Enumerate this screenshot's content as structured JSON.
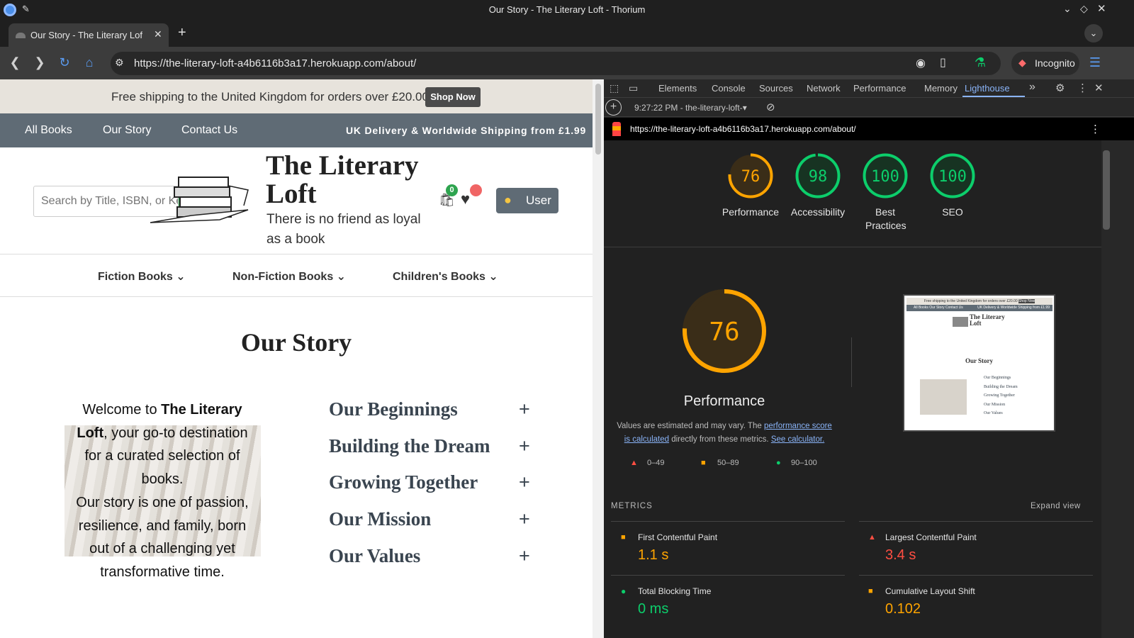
{
  "window": {
    "title": "Our Story - The Literary Loft - Thorium"
  },
  "tab": {
    "label": "Our Story - The Literary Lof"
  },
  "address": {
    "url": "https://the-literary-loft-a4b6116b3a17.herokuapp.com/about/",
    "incognito_label": "Incognito"
  },
  "site": {
    "promo_text": "Free shipping to the United Kingdom for orders over £20.00",
    "promo_button": "Shop Now",
    "nav": [
      "All Books",
      "Our Story",
      "Contact Us"
    ],
    "nav_right": "UK Delivery & Worldwide Shipping from £1.99",
    "search_placeholder": "Search by Title, ISBN, or Keyword",
    "brand_title_line1": "The Literary",
    "brand_title_line2": "Loft",
    "tagline_line1": "There is no friend as loyal",
    "tagline_line2": "as a book",
    "cart_count": "0",
    "user_button": "User",
    "categories": [
      "Fiction Books",
      "Non-Fiction Books",
      "Children's Books"
    ],
    "page_heading": "Our Story",
    "intro": {
      "l1a": "Welcome to ",
      "l1b": "The Literary",
      "l2a": "Loft",
      "l2b": ", your go-to destination",
      "l3": "for a curated selection of",
      "l4": "books.",
      "l5": "Our story is one of passion,",
      "l6": "resilience, and family, born",
      "l7": "out of a challenging yet",
      "l8": "transformative time."
    },
    "accordion": [
      "Our Beginnings",
      "Building the Dream",
      "Growing Together",
      "Our Mission",
      "Our Values"
    ]
  },
  "devtools": {
    "tabs": [
      "Elements",
      "Console",
      "Sources",
      "Network",
      "Performance",
      "Memory",
      "Lighthouse"
    ],
    "active_tab": "Lighthouse",
    "report_selector": "9:27:22 PM - the-literary-loft-",
    "report_url": "https://the-literary-loft-a4b6116b3a17.herokuapp.com/about/",
    "scores": [
      {
        "label": "Performance",
        "value": 76,
        "color": "#ffa400"
      },
      {
        "label": "Accessibility",
        "value": 98,
        "color": "#0cce6b"
      },
      {
        "label": "Best Practices",
        "value": 100,
        "color": "#0cce6b"
      },
      {
        "label": "SEO",
        "value": 100,
        "color": "#0cce6b"
      }
    ],
    "big_score": {
      "label": "Performance",
      "value": 76
    },
    "note_pre": "Values are estimated and may vary. The ",
    "note_link1a": "performance score",
    "note_link1b": "is calculated",
    "note_mid": " directly from these metrics. ",
    "note_link2": "See calculator.",
    "legend": [
      "0–49",
      "50–89",
      "90–100"
    ],
    "metrics_header": "METRICS",
    "expand_view": "Expand view",
    "metrics": [
      {
        "name": "First Contentful Paint",
        "value": "1.1 s",
        "status": "average"
      },
      {
        "name": "Largest Contentful Paint",
        "value": "3.4 s",
        "status": "fail"
      },
      {
        "name": "Total Blocking Time",
        "value": "0 ms",
        "status": "pass"
      },
      {
        "name": "Cumulative Layout Shift",
        "value": "0.102",
        "status": "average"
      }
    ],
    "thumb": {
      "promo": "Free shipping to the United Kingdom for orders over £20.00",
      "promo_btn": "Shop Now",
      "nav": "All Books   Our Story   Contact Us",
      "nav_right": "UK Delivery & Worldwide Shipping from £1.99",
      "brand": "The Literary Loft",
      "heading": "Our Story",
      "acc": [
        "Our Beginnings",
        "Building the Dream",
        "Growing Together",
        "Our Mission",
        "Our Values"
      ]
    }
  }
}
